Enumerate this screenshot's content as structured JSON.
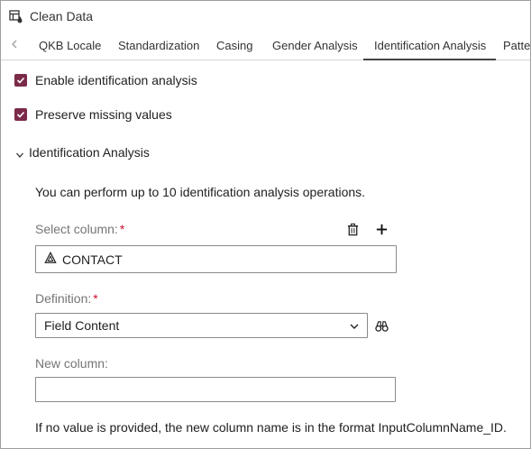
{
  "window": {
    "title": "Clean Data",
    "icon": "table-clean-icon"
  },
  "tabs": [
    {
      "label": "QKB Locale",
      "active": false
    },
    {
      "label": "Standardization",
      "active": false
    },
    {
      "label": "Casing",
      "active": false
    },
    {
      "label": "Gender Analysis",
      "active": false
    },
    {
      "label": "Identification Analysis",
      "active": true
    },
    {
      "label": "Patter",
      "active": false
    }
  ],
  "options": {
    "enable_analysis": {
      "label": "Enable identification analysis",
      "checked": true
    },
    "preserve_missing": {
      "label": "Preserve missing values",
      "checked": true
    }
  },
  "section": {
    "title": "Identification Analysis",
    "expanded": true,
    "info": "You can perform up to 10 identification analysis operations."
  },
  "fields": {
    "select_column": {
      "label": "Select column:",
      "required_mark": "*",
      "value": "CONTACT",
      "value_icon": "character-column-icon"
    },
    "definition": {
      "label": "Definition:",
      "required_mark": "*",
      "value": "Field Content"
    },
    "new_column": {
      "label": "New column:",
      "value": "",
      "placeholder": ""
    }
  },
  "help": "If no value is provided, the new column name is in the format InputColumnName_ID.",
  "colors": {
    "accent": "#7b2a4a",
    "required": "#c8102e"
  }
}
